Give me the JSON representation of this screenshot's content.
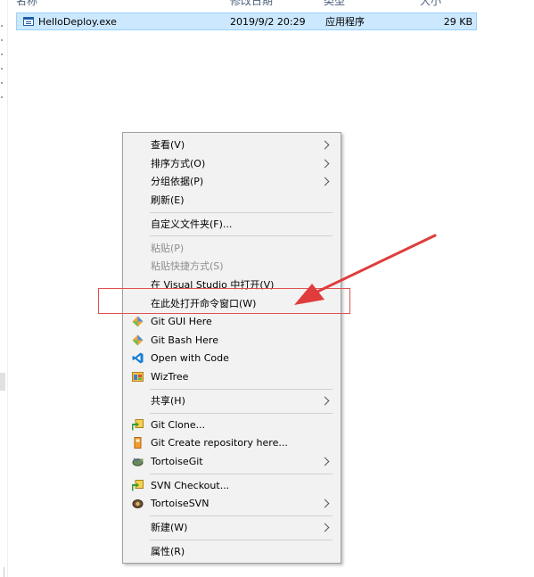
{
  "header": {
    "col_name": "名称",
    "col_modified": "修改日期",
    "col_type": "类型",
    "col_size": "大小"
  },
  "file": {
    "name": "HelloDeploy.exe",
    "modified": "2019/9/2 20:29",
    "type": "应用程序",
    "size": "29 KB",
    "icon": "exe-icon"
  },
  "menu": {
    "view": "查看(V)",
    "sort_by": "排序方式(O)",
    "group_by": "分组依据(P)",
    "refresh": "刷新(E)",
    "customize_folder": "自定义文件夹(F)...",
    "paste": "粘贴(P)",
    "paste_shortcut": "粘贴快捷方式(S)",
    "open_in_vs": "在 Visual Studio 中打开(V)",
    "open_cmd_here": "在此处打开命令窗口(W)",
    "git_gui": "Git GUI Here",
    "git_bash": "Git Bash Here",
    "open_with_code": "Open with Code",
    "wiztree": "WizTree",
    "share": "共享(H)",
    "git_clone": "Git Clone...",
    "git_create_repo": "Git Create repository here...",
    "tortoise_git": "TortoiseGit",
    "svn_checkout": "SVN Checkout...",
    "tortoise_svn": "TortoiseSVN",
    "new": "新建(W)",
    "properties": "属性(R)"
  },
  "icons": {
    "git": "git-diamond-icon",
    "vscode": "vscode-icon",
    "wiztree": "wiztree-icon",
    "git_clone": "git-clone-icon",
    "git_create": "git-create-repo-icon",
    "tortoise_git": "tortoisegit-icon",
    "svn_checkout": "svn-checkout-icon",
    "tortoise_svn": "tortoisesvn-icon"
  },
  "colors": {
    "selection": "#cce8ff",
    "annotation": "#e03c3c",
    "menu_bg": "#f2f2f2"
  }
}
